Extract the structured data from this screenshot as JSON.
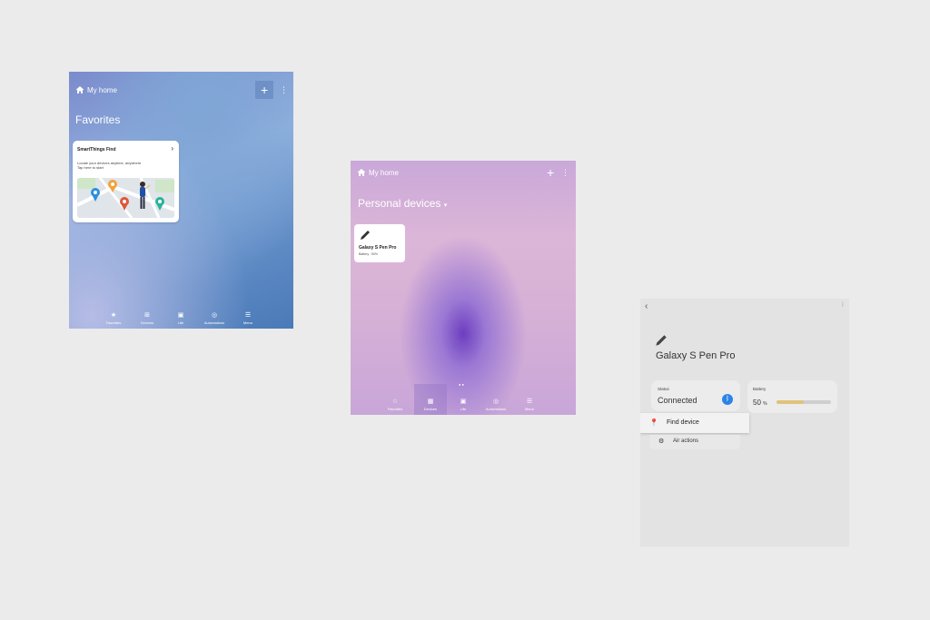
{
  "screen1": {
    "header_title": "My home",
    "title": "Favorites",
    "card": {
      "title": "SmartThings Find",
      "line1": "Locate your devices anytime, anywhere",
      "line2": "Tap here to start"
    },
    "nav": [
      "Favorites",
      "Devices",
      "Life",
      "Automations",
      "Menu"
    ]
  },
  "screen2": {
    "header_title": "My home",
    "title": "Personal devices",
    "device": {
      "name": "Galaxy S Pen Pro",
      "battery": "Battery : 50%"
    },
    "nav": [
      "Favorites",
      "Devices",
      "Life",
      "Automations",
      "Menu"
    ]
  },
  "screen3": {
    "title": "Galaxy S Pen Pro",
    "status_label": "Status",
    "status_value": "Connected",
    "battery_label": "Battery",
    "battery_value": "50",
    "battery_unit": "%",
    "battery_level": 0.5,
    "find_device": "Find device",
    "air_actions": "Air actions"
  },
  "colors": {
    "bluetooth": "#2c84e6",
    "battery_fill": "#e0c27a"
  }
}
